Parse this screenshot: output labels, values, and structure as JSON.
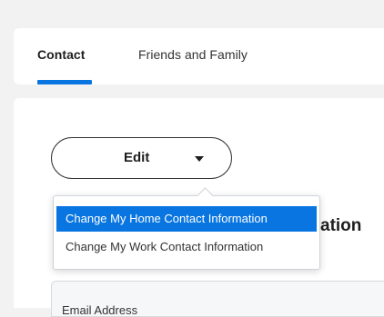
{
  "tabs": [
    {
      "label": "Contact"
    },
    {
      "label": "Friends and Family"
    }
  ],
  "edit_button": {
    "label": "Edit"
  },
  "heading": {
    "visible_text": "ation"
  },
  "menu": {
    "items": [
      {
        "label": "Change My Home Contact Information"
      },
      {
        "label": "Change My Work Contact Information"
      }
    ]
  },
  "section": {
    "label": "Email Address"
  },
  "colors": {
    "accent": "#0875e1",
    "background": "#f2f2f2",
    "card": "#ffffff"
  }
}
